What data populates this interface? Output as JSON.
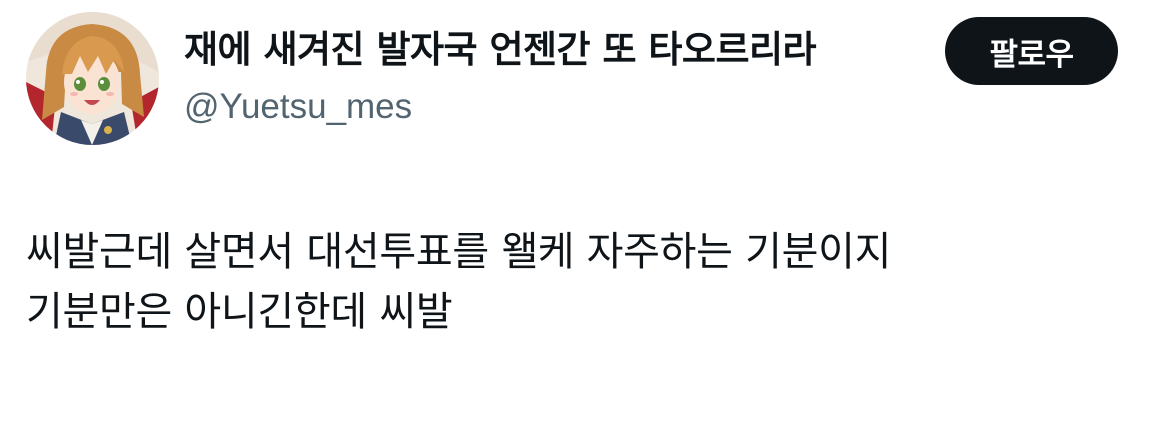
{
  "author": {
    "display_name": "재에 새겨진 발자국 언젠간 또 타오르리라",
    "handle": "@Yuetsu_mes",
    "avatar_icon": "anime-character-avatar"
  },
  "follow_button": {
    "label": "팔로우"
  },
  "tweet": {
    "lines": [
      "씨발근데 살면서 대선투표를 왤케 자주하는 기분이지",
      "기분만은 아니긴한데 씨발"
    ]
  },
  "colors": {
    "text_primary": "#0f1419",
    "text_secondary": "#536471",
    "button_bg": "#0f1419",
    "button_text": "#ffffff",
    "background": "#ffffff"
  }
}
